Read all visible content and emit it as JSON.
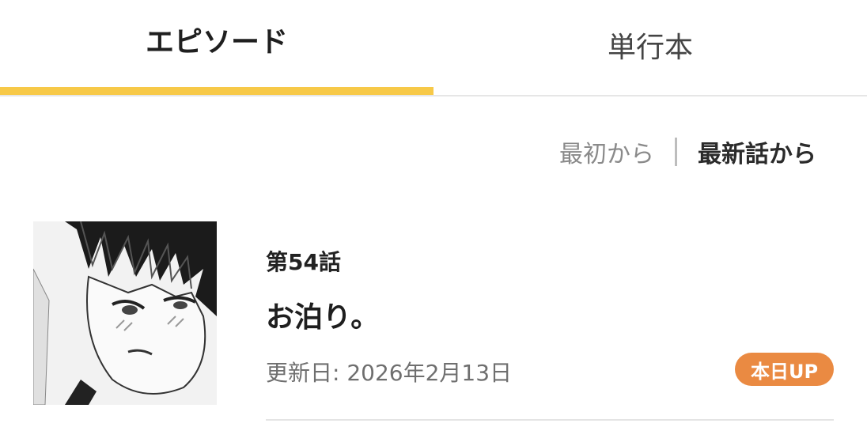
{
  "tabs": {
    "episode": "エピソード",
    "volume": "単行本"
  },
  "sort": {
    "oldest": "最初から",
    "newest": "最新話から"
  },
  "episodes": [
    {
      "number": "第54話",
      "title": "お泊り。",
      "date": "更新日: 2026年2月13日",
      "badge": "本日UP"
    }
  ],
  "colors": {
    "tab_indicator": "#f7c948",
    "badge_bg": "#ea8a42"
  }
}
